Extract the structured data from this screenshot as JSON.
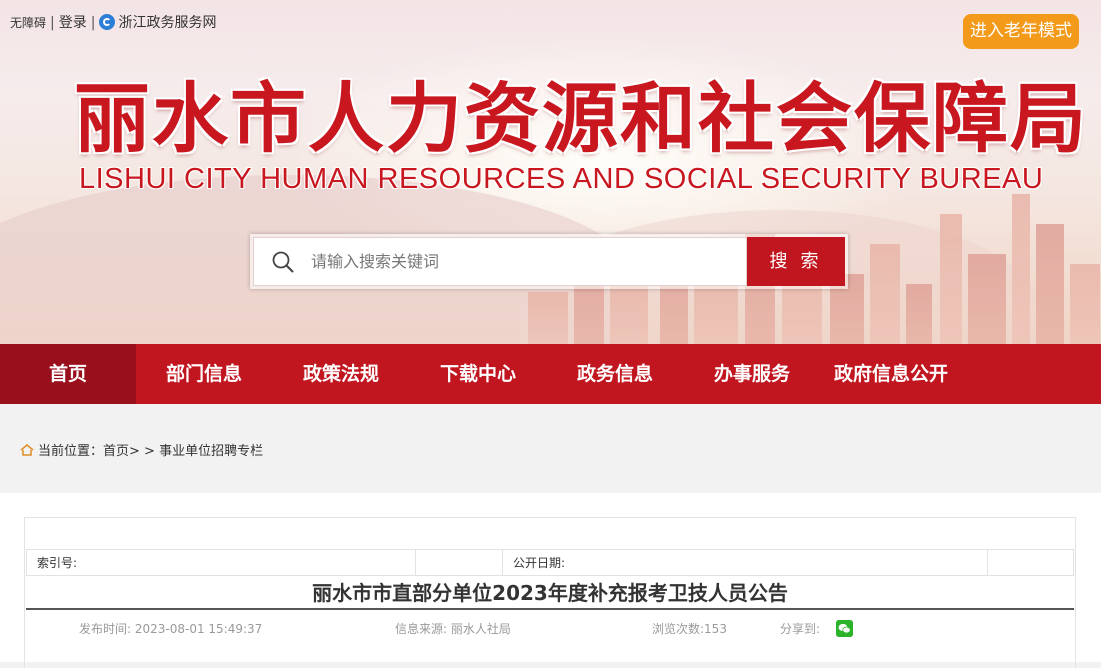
{
  "topbar": {
    "accessibility": "无障碍",
    "login": "登录",
    "portal": "浙江政务服务网",
    "elder_mode": "进入老年模式"
  },
  "header": {
    "title_cn": "丽水市人力资源和社会保障局",
    "title_en": "LISHUI CITY HUMAN RESOURCES AND SOCIAL SECURITY BUREAU"
  },
  "search": {
    "placeholder": "请输入搜索关键词",
    "button": "搜 索"
  },
  "nav": {
    "items": [
      {
        "label": "首页"
      },
      {
        "label": "部门信息"
      },
      {
        "label": "政策法规"
      },
      {
        "label": "下载中心"
      },
      {
        "label": "政务信息"
      },
      {
        "label": "办事服务"
      },
      {
        "label": "政府信息公开"
      }
    ]
  },
  "breadcrumb": {
    "prefix": "当前位置：",
    "home": "首页",
    "separator": "> >",
    "current": "事业单位招聘专栏"
  },
  "article": {
    "index_label": "索引号:",
    "index_value": "",
    "publish_label": "公开日期:",
    "publish_value": "",
    "title": "丽水市市直部分单位2023年度补充报考卫技人员公告",
    "published": "发布时间: 2023-08-01 15:49:37",
    "source": "信息来源: 丽水人社局",
    "views": "浏览次数:153",
    "share": "分享到:"
  },
  "colors": {
    "brand_red": "#c1161f",
    "active_nav": "#9a0f1c",
    "elder_button": "#f39a1a",
    "wechat_green": "#2bb32b"
  },
  "icons": [
    "search-icon",
    "home-icon",
    "wechat-icon",
    "gov-portal-logo-icon"
  ]
}
